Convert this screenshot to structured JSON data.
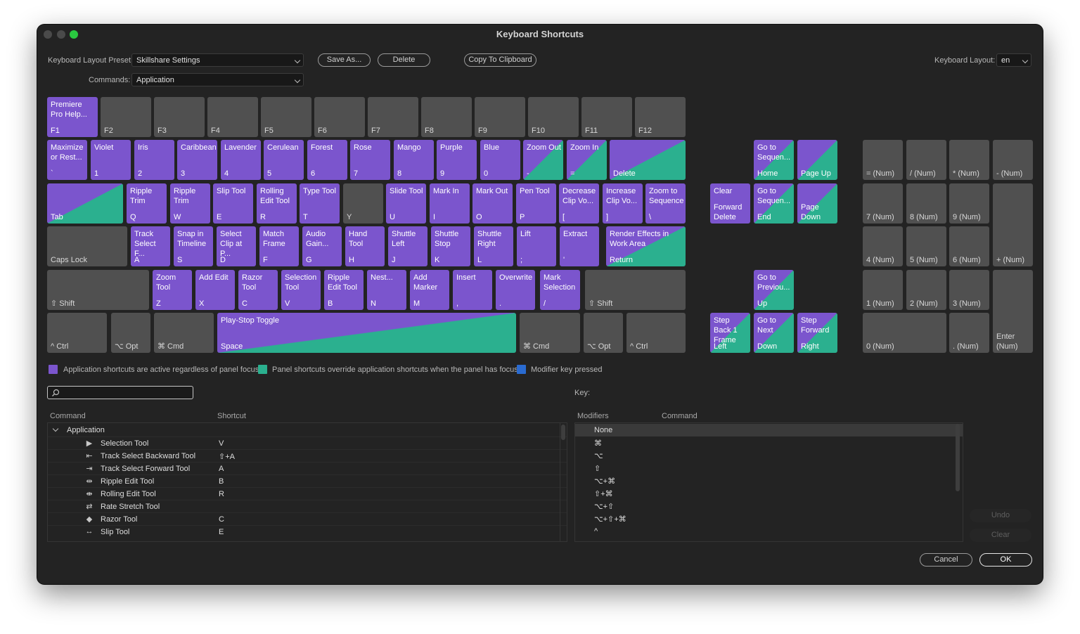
{
  "window": {
    "title": "Keyboard Shortcuts"
  },
  "controls": {
    "preset_label": "Keyboard Layout Preset:",
    "preset_value": "Skillshare Settings",
    "save_as": "Save As...",
    "delete": "Delete",
    "copy_clipboard": "Copy To Clipboard",
    "layout_label": "Keyboard Layout:",
    "layout_value": "en",
    "commands_label": "Commands:",
    "commands_value": "Application"
  },
  "keys": {
    "f1": {
      "top": "Premiere Pro Help...",
      "bot": "F1",
      "kind": "app"
    },
    "f2": {
      "top": "",
      "bot": "F2",
      "kind": "empty"
    },
    "f3": {
      "top": "",
      "bot": "F3",
      "kind": "empty"
    },
    "f4": {
      "top": "",
      "bot": "F4",
      "kind": "empty"
    },
    "f5": {
      "top": "",
      "bot": "F5",
      "kind": "empty"
    },
    "f6": {
      "top": "",
      "bot": "F6",
      "kind": "empty"
    },
    "f7": {
      "top": "",
      "bot": "F7",
      "kind": "empty"
    },
    "f8": {
      "top": "",
      "bot": "F8",
      "kind": "empty"
    },
    "f9": {
      "top": "",
      "bot": "F9",
      "kind": "empty"
    },
    "f10": {
      "top": "",
      "bot": "F10",
      "kind": "empty"
    },
    "f11": {
      "top": "",
      "bot": "F11",
      "kind": "empty"
    },
    "f12": {
      "top": "",
      "bot": "F12",
      "kind": "empty"
    },
    "backtick": {
      "top": "Maximize or Rest...",
      "bot": "`",
      "kind": "app"
    },
    "k1": {
      "top": "Violet",
      "bot": "1",
      "kind": "app"
    },
    "k2": {
      "top": "Iris",
      "bot": "2",
      "kind": "app"
    },
    "k3": {
      "top": "Caribbean",
      "bot": "3",
      "kind": "app"
    },
    "k4": {
      "top": "Lavender",
      "bot": "4",
      "kind": "app"
    },
    "k5": {
      "top": "Cerulean",
      "bot": "5",
      "kind": "app"
    },
    "k6": {
      "top": "Forest",
      "bot": "6",
      "kind": "app"
    },
    "k7": {
      "top": "Rose",
      "bot": "7",
      "kind": "app"
    },
    "k8": {
      "top": "Mango",
      "bot": "8",
      "kind": "app"
    },
    "k9": {
      "top": "Purple",
      "bot": "9",
      "kind": "app"
    },
    "k0": {
      "top": "Blue",
      "bot": "0",
      "kind": "app"
    },
    "minus": {
      "top": "Zoom Out",
      "bot": "-",
      "kind": "mix"
    },
    "equals": {
      "top": "Zoom In",
      "bot": "=",
      "kind": "mix"
    },
    "delete": {
      "top": "",
      "bot": "Delete",
      "kind": "mix"
    },
    "tab": {
      "top": "",
      "bot": "Tab",
      "kind": "mix"
    },
    "q": {
      "top": "Ripple Trim",
      "bot": "Q",
      "kind": "app"
    },
    "w": {
      "top": "Ripple Trim",
      "bot": "W",
      "kind": "app"
    },
    "e": {
      "top": "Slip Tool",
      "bot": "E",
      "kind": "app"
    },
    "r": {
      "top": "Rolling Edit Tool",
      "bot": "R",
      "kind": "app"
    },
    "t": {
      "top": "Type Tool",
      "bot": "T",
      "kind": "app"
    },
    "y": {
      "top": "",
      "bot": "Y",
      "kind": "empty"
    },
    "u": {
      "top": "Slide Tool",
      "bot": "U",
      "kind": "app"
    },
    "i": {
      "top": "Mark In",
      "bot": "I",
      "kind": "app"
    },
    "o": {
      "top": "Mark Out",
      "bot": "O",
      "kind": "app"
    },
    "p": {
      "top": "Pen Tool",
      "bot": "P",
      "kind": "app"
    },
    "lbracket": {
      "top": "Decrease Clip Vo...",
      "bot": "[",
      "kind": "app"
    },
    "rbracket": {
      "top": "Increase Clip Vo...",
      "bot": "]",
      "kind": "app"
    },
    "backslash": {
      "top": "Zoom to Sequence",
      "bot": "\\",
      "kind": "app"
    },
    "capslock": {
      "top": "",
      "bot": "Caps Lock",
      "kind": "empty"
    },
    "a": {
      "top": "Track Select F...",
      "bot": "A",
      "kind": "app"
    },
    "s": {
      "top": "Snap in Timeline",
      "bot": "S",
      "kind": "app"
    },
    "d": {
      "top": "Select Clip at P...",
      "bot": "D",
      "kind": "app"
    },
    "f": {
      "top": "Match Frame",
      "bot": "F",
      "kind": "app"
    },
    "g": {
      "top": "Audio Gain...",
      "bot": "G",
      "kind": "app"
    },
    "h": {
      "top": "Hand Tool",
      "bot": "H",
      "kind": "app"
    },
    "j": {
      "top": "Shuttle Left",
      "bot": "J",
      "kind": "app"
    },
    "k": {
      "top": "Shuttle Stop",
      "bot": "K",
      "kind": "app"
    },
    "l": {
      "top": "Shuttle Right",
      "bot": "L",
      "kind": "app"
    },
    "semicolon": {
      "top": "Lift",
      "bot": ";",
      "kind": "app"
    },
    "quote": {
      "top": "Extract",
      "bot": "'",
      "kind": "app"
    },
    "return": {
      "top": "Render Effects in Work Area",
      "bot": "Return",
      "kind": "mix"
    },
    "lshift": {
      "top": "",
      "bot": "⇧ Shift",
      "kind": "empty"
    },
    "z": {
      "top": "Zoom Tool",
      "bot": "Z",
      "kind": "app"
    },
    "x": {
      "top": "Add Edit",
      "bot": "X",
      "kind": "app"
    },
    "c": {
      "top": "Razor Tool",
      "bot": "C",
      "kind": "app"
    },
    "v": {
      "top": "Selection Tool",
      "bot": "V",
      "kind": "app"
    },
    "b": {
      "top": "Ripple Edit Tool",
      "bot": "B",
      "kind": "app"
    },
    "n": {
      "top": "Nest...",
      "bot": "N",
      "kind": "app"
    },
    "m": {
      "top": "Add Marker",
      "bot": "M",
      "kind": "app"
    },
    "comma": {
      "top": "Insert",
      "bot": ",",
      "kind": "app"
    },
    "period": {
      "top": "Overwrite",
      "bot": ".",
      "kind": "app"
    },
    "slash": {
      "top": "Mark Selection",
      "bot": "/",
      "kind": "app"
    },
    "rshift": {
      "top": "",
      "bot": "⇧ Shift",
      "kind": "empty"
    },
    "lctrl": {
      "top": "",
      "bot": "^ Ctrl",
      "kind": "empty"
    },
    "lopt": {
      "top": "",
      "bot": "⌥ Opt",
      "kind": "empty"
    },
    "lcmd": {
      "top": "",
      "bot": "⌘ Cmd",
      "kind": "empty"
    },
    "space": {
      "top": "Play-Stop Toggle",
      "bot": "Space",
      "kind": "mix"
    },
    "rcmd": {
      "top": "",
      "bot": "⌘ Cmd",
      "kind": "empty"
    },
    "ropt": {
      "top": "",
      "bot": "⌥ Opt",
      "kind": "empty"
    },
    "rctrl": {
      "top": "",
      "bot": "^ Ctrl",
      "kind": "empty"
    },
    "home": {
      "top": "Go to Sequen...",
      "bot": "Home",
      "kind": "mix"
    },
    "pageup": {
      "top": "",
      "bot": "Page Up",
      "kind": "mix"
    },
    "fwddelete": {
      "top": "Clear",
      "bot": "Forward Delete",
      "kind": "app"
    },
    "end": {
      "top": "Go to Sequen...",
      "bot": "End",
      "kind": "mix"
    },
    "pagedown": {
      "top": "",
      "bot": "Page Down",
      "kind": "mix"
    },
    "up": {
      "top": "Go to Previou...",
      "bot": "Up",
      "kind": "mix"
    },
    "left": {
      "top": "Step Back 1 Frame",
      "bot": "Left",
      "kind": "mix"
    },
    "down": {
      "top": "Go to Next",
      "bot": "Down",
      "kind": "mix"
    },
    "right": {
      "top": "Step Forward",
      "bot": "Right",
      "kind": "mix"
    },
    "numeq": {
      "top": "",
      "bot": "= (Num)",
      "kind": "empty"
    },
    "numdiv": {
      "top": "",
      "bot": "/ (Num)",
      "kind": "empty"
    },
    "nummul": {
      "top": "",
      "bot": "* (Num)",
      "kind": "empty"
    },
    "numsub": {
      "top": "",
      "bot": "- (Num)",
      "kind": "empty"
    },
    "num7": {
      "top": "",
      "bot": "7 (Num)",
      "kind": "empty"
    },
    "num8": {
      "top": "",
      "bot": "8 (Num)",
      "kind": "empty"
    },
    "num9": {
      "top": "",
      "bot": "9 (Num)",
      "kind": "empty"
    },
    "numadd": {
      "top": "",
      "bot": "+ (Num)",
      "kind": "empty"
    },
    "num4": {
      "top": "",
      "bot": "4 (Num)",
      "kind": "empty"
    },
    "num5": {
      "top": "",
      "bot": "5 (Num)",
      "kind": "empty"
    },
    "num6": {
      "top": "",
      "bot": "6 (Num)",
      "kind": "empty"
    },
    "num1": {
      "top": "",
      "bot": "1 (Num)",
      "kind": "empty"
    },
    "num2": {
      "top": "",
      "bot": "2 (Num)",
      "kind": "empty"
    },
    "num3": {
      "top": "",
      "bot": "3 (Num)",
      "kind": "empty"
    },
    "numenter": {
      "top": "",
      "bot": "Enter (Num)",
      "kind": "empty"
    },
    "num0": {
      "top": "",
      "bot": "0 (Num)",
      "kind": "empty"
    },
    "numdot": {
      "top": "",
      "bot": ". (Num)",
      "kind": "empty"
    }
  },
  "legend": {
    "app": "Application shortcuts are active regardless of panel focus",
    "panel": "Panel shortcuts override application shortcuts when the panel has focus",
    "modifier": "Modifier key pressed",
    "colors": {
      "app": "#7b55cd",
      "panel": "#2bb08f",
      "modifier": "#2a6bd1"
    }
  },
  "search": {
    "placeholder": ""
  },
  "command_table": {
    "col_command": "Command",
    "col_shortcut": "Shortcut",
    "group": "Application",
    "rows": [
      {
        "icon": "selection-tool-icon",
        "glyph": "▶",
        "command": "Selection Tool",
        "shortcut": "V"
      },
      {
        "icon": "track-select-backward-icon",
        "glyph": "⇤",
        "command": "Track Select Backward Tool",
        "shortcut": "⇧+A"
      },
      {
        "icon": "track-select-forward-icon",
        "glyph": "⇥",
        "command": "Track Select Forward Tool",
        "shortcut": "A"
      },
      {
        "icon": "ripple-edit-icon",
        "glyph": "⇹",
        "command": "Ripple Edit Tool",
        "shortcut": "B"
      },
      {
        "icon": "rolling-edit-icon",
        "glyph": "⇼",
        "command": "Rolling Edit Tool",
        "shortcut": "R"
      },
      {
        "icon": "rate-stretch-icon",
        "glyph": "⇄",
        "command": "Rate Stretch Tool",
        "shortcut": ""
      },
      {
        "icon": "razor-icon",
        "glyph": "◆",
        "command": "Razor Tool",
        "shortcut": "C"
      },
      {
        "icon": "slip-icon",
        "glyph": "↔",
        "command": "Slip Tool",
        "shortcut": "E"
      }
    ]
  },
  "key_panel": {
    "key_label": "Key:",
    "col_modifiers": "Modifiers",
    "col_command": "Command",
    "modifiers": [
      "None",
      "⌘",
      "⌥",
      "⇧",
      "⌥+⌘",
      "⇧+⌘",
      "⌥+⇧",
      "⌥+⇧+⌘",
      "^"
    ]
  },
  "buttons": {
    "undo": "Undo",
    "clear": "Clear",
    "cancel": "Cancel",
    "ok": "OK"
  }
}
